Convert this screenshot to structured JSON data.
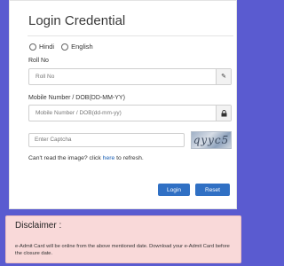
{
  "login": {
    "title": "Login Credential",
    "languages": [
      "Hindi",
      "English"
    ],
    "roll_label": "Roll No",
    "roll_placeholder": "Roll No",
    "roll_icon": "pencil-icon",
    "dob_label": "Mobile Number / DOB(DD-MM-YY)",
    "dob_placeholder": "Mobile Number / DOB(dd-mm-yy)",
    "dob_icon": "lock-icon",
    "captcha_placeholder": "Enter Captcha",
    "captcha_text": "qyyc5",
    "refresh_prefix": "Can't read the image? click ",
    "refresh_link": "here",
    "refresh_suffix": " to refresh.",
    "login_button": "Login",
    "reset_button": "Reset"
  },
  "disclaimer": {
    "title": "Disclaimer :",
    "text": "e-Admit Card will be online from the above mentioned date. Download your e-Admit Card before the closure date."
  },
  "colors": {
    "background": "#5a5bd0",
    "button": "#3070c4",
    "disclaimer_bg": "#f9d9d9"
  }
}
